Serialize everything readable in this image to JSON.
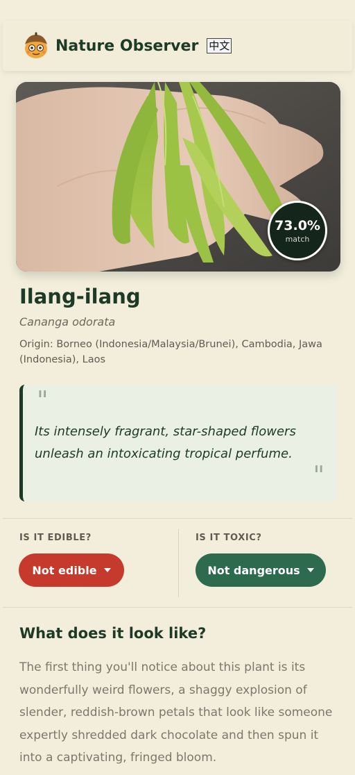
{
  "header": {
    "app_title": "Nature Observer",
    "lang_button": "中文",
    "logo_icon": "acorn-mascot-icon"
  },
  "result": {
    "match_value": "73.0%",
    "match_label": "match",
    "common_name": "Ilang-ilang",
    "scientific_name": "Cananga odorata",
    "origin": "Origin: Borneo (Indonesia/Malaysia/Brunei), Cambodia, Jawa (Indonesia), Laos"
  },
  "quote": {
    "open_mark": "\"",
    "close_mark": "\"",
    "text": "Its intensely fragrant, star-shaped flowers unleash an intoxicating tropical perfume."
  },
  "edible": {
    "label": "IS IT EDIBLE?",
    "value": "Not edible",
    "color": "#c53a2c"
  },
  "toxic": {
    "label": "IS IT TOXIC?",
    "value": "Not dangerous",
    "color": "#2d6a4e"
  },
  "description": {
    "title": "What does it look like?",
    "body": "The first thing you'll notice about this plant is its wonderfully weird flowers, a shaggy explosion of slender, reddish-brown petals that look like someone expertly shredded dark chocolate and then spun it into a captivating, fringed bloom."
  },
  "colors": {
    "background": "#f2eedb",
    "primary_text": "#1d3a27",
    "quote_bg": "#eaf0e3"
  }
}
